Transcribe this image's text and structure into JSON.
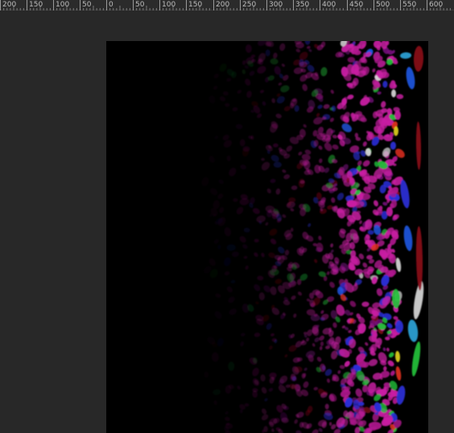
{
  "ruler": {
    "orientation": "horizontal",
    "labels": [
      "200",
      "150",
      "100",
      "50",
      "0",
      "50",
      "100",
      "150",
      "200",
      "250",
      "300",
      "350",
      "400",
      "450",
      "500",
      "550",
      "600"
    ]
  },
  "document": {
    "content": "fluorescence microscopy image of stained cell nuclei",
    "background_color": "#000000",
    "nucleus_colors": [
      "#b0198e",
      "#c81fa2",
      "#7a1280",
      "#2a2fd8",
      "#1f56e0",
      "#2aa3d8",
      "#22c23a",
      "#e0d020",
      "#e03020",
      "#d8d8d8",
      "#8a0a18"
    ]
  },
  "workspace": {
    "pasteboard_color": "#282828",
    "ruler_color": "#2b2b2b"
  }
}
